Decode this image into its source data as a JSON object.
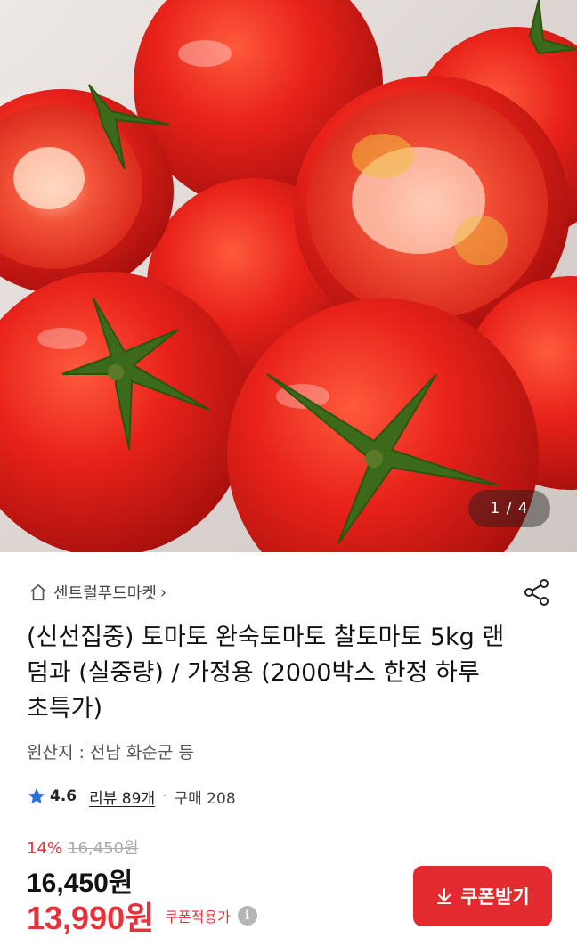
{
  "gallery": {
    "counter": "1 / 4"
  },
  "store": {
    "name": "센트럴푸드마켓",
    "chevron": "›"
  },
  "product": {
    "title": "(신선집중) 토마토 완숙토마토 찰토마토 5kg 랜덤과 (실중량) / 가정용 (2000박스 한정 하루 초특가)",
    "origin": "원산지 : 전남 화순군 등"
  },
  "rating": {
    "score": "4.6",
    "reviews": "리뷰 89개",
    "separator": "·",
    "sales": "구매 208"
  },
  "price": {
    "discount_rate": "14%",
    "original_price": "16,450원",
    "price": "16,450원",
    "coupon_price": "13,990원",
    "coupon_label": "쿠폰적용가",
    "info_icon": "i"
  },
  "coupon_button": {
    "label": "쿠폰받기"
  },
  "icons": {
    "home": "home-icon",
    "share": "share-icon",
    "star": "star-icon",
    "info": "info-icon",
    "download": "download-icon"
  },
  "colors": {
    "accent": "#e32a2e",
    "sale_red": "#e8313a",
    "star_blue": "#2c6fe0"
  }
}
